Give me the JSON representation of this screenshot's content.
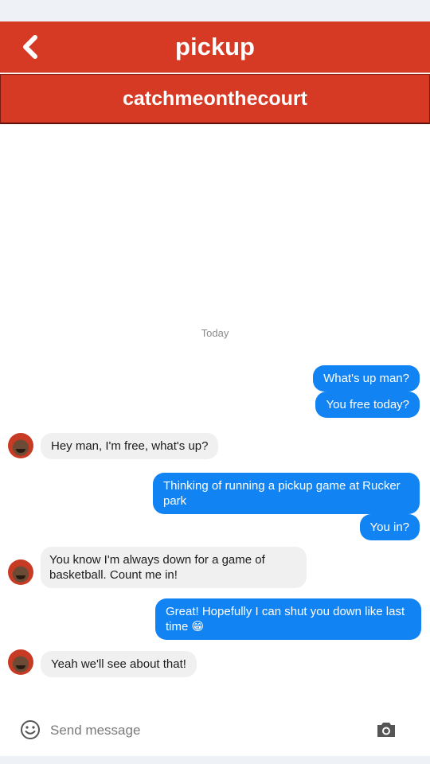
{
  "header": {
    "title": "pickup",
    "subtitle": "catchmeonthecourt",
    "color": "#d63a25",
    "back_icon": "chevron-left-icon"
  },
  "conversation": {
    "date_label": "Today",
    "outgoing_color": "#1283f3",
    "incoming_color": "#f0f0f0",
    "messages": [
      {
        "from": "me",
        "text": "What's up man?"
      },
      {
        "from": "me",
        "text": "You free today?"
      },
      {
        "from": "them",
        "text": "Hey man, I'm free, what's up?"
      },
      {
        "from": "me",
        "text": "Thinking of running a pickup game at Rucker park"
      },
      {
        "from": "me",
        "text": "You in?"
      },
      {
        "from": "them",
        "text": "You know I'm always down for a game of basketball. Count me in!"
      },
      {
        "from": "me",
        "text": "Great! Hopefully I can shut you down like last time",
        "emoji": "😁"
      },
      {
        "from": "them",
        "text": "Yeah we'll see about that!"
      }
    ]
  },
  "composer": {
    "placeholder": "Send message",
    "value": "",
    "emoji_icon": "smiley-icon",
    "camera_icon": "camera-icon"
  }
}
